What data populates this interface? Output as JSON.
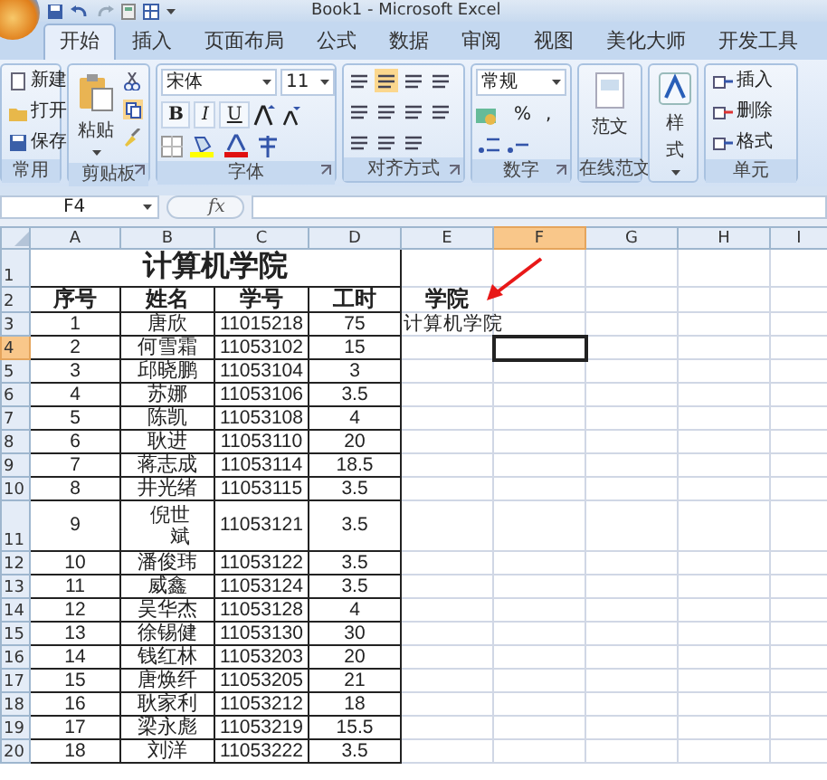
{
  "window": {
    "title": "Book1 - Microsoft Excel"
  },
  "tabs": [
    {
      "label": "开始",
      "selected": true
    },
    {
      "label": "插入",
      "selected": false
    },
    {
      "label": "页面布局",
      "selected": false
    },
    {
      "label": "公式",
      "selected": false
    },
    {
      "label": "数据",
      "selected": false
    },
    {
      "label": "审阅",
      "selected": false
    },
    {
      "label": "视图",
      "selected": false
    },
    {
      "label": "美化大师",
      "selected": false
    },
    {
      "label": "开发工具",
      "selected": false
    }
  ],
  "ribbon": {
    "groups": [
      {
        "kind": "file",
        "label": "常用",
        "items": [
          "新建",
          "打开",
          "保存"
        ]
      },
      {
        "kind": "clipboard",
        "label": "剪贴板",
        "paste": "粘贴"
      },
      {
        "kind": "font",
        "label": "字体",
        "font_name": "宋体",
        "font_size": "11",
        "buttons": [
          "B",
          "I",
          "U"
        ]
      },
      {
        "kind": "align",
        "label": "对齐方式"
      },
      {
        "kind": "number",
        "label": "数字",
        "format": "常规",
        "buttons": [
          "%",
          ","
        ]
      },
      {
        "kind": "big",
        "label": "在线范文",
        "button": "范文"
      },
      {
        "kind": "style",
        "button": "样式"
      },
      {
        "kind": "cells",
        "label": "单元",
        "items": [
          "插入",
          "删除",
          "格式"
        ]
      }
    ]
  },
  "formula_bar": {
    "name_box": "F4",
    "fx": "fx"
  },
  "sheet": {
    "columns": [
      {
        "label": "A",
        "selected": false
      },
      {
        "label": "B",
        "selected": false
      },
      {
        "label": "C",
        "selected": false
      },
      {
        "label": "D",
        "selected": false
      },
      {
        "label": "E",
        "selected": false
      },
      {
        "label": "F",
        "selected": true
      },
      {
        "label": "G",
        "selected": false
      },
      {
        "label": "H",
        "selected": false
      },
      {
        "label": "I",
        "selected": false
      }
    ],
    "rows": [
      {
        "header": "1",
        "selected": false,
        "kind": "title",
        "title": "计算机学院"
      },
      {
        "header": "2",
        "selected": false,
        "kind": "header",
        "cells": [
          "序号",
          "姓名",
          "学号",
          "工时"
        ],
        "column_e": "学院"
      },
      {
        "header": "3",
        "selected": false,
        "kind": "data",
        "cells": [
          "1",
          "唐欣",
          "11015218",
          "75"
        ],
        "column_e": "计算机学院"
      },
      {
        "header": "4",
        "selected": true,
        "kind": "data",
        "cells": [
          "2",
          "何雪霜",
          "11053102",
          "15"
        ]
      },
      {
        "header": "5",
        "selected": false,
        "kind": "data",
        "cells": [
          "3",
          "邱晓鹏",
          "11053104",
          "3"
        ]
      },
      {
        "header": "6",
        "selected": false,
        "kind": "data",
        "cells": [
          "4",
          "苏娜",
          "11053106",
          "3.5"
        ]
      },
      {
        "header": "7",
        "selected": false,
        "kind": "data",
        "cells": [
          "5",
          "陈凯",
          "11053108",
          "4"
        ]
      },
      {
        "header": "8",
        "selected": false,
        "kind": "data",
        "cells": [
          "6",
          "耿进",
          "11053110",
          "20"
        ]
      },
      {
        "header": "9",
        "selected": false,
        "kind": "data",
        "cells": [
          "7",
          "蒋志成",
          "11053114",
          "18.5"
        ]
      },
      {
        "header": "10",
        "selected": false,
        "kind": "data",
        "cells": [
          "8",
          "井光绪",
          "11053115",
          "3.5"
        ]
      },
      {
        "header": "11",
        "selected": false,
        "kind": "tall",
        "cells": [
          "9",
          "倪世斌",
          "11053121",
          "3.5"
        ]
      },
      {
        "header": "12",
        "selected": false,
        "kind": "data",
        "cells": [
          "10",
          "潘俊玮",
          "11053122",
          "3.5"
        ]
      },
      {
        "header": "13",
        "selected": false,
        "kind": "data",
        "cells": [
          "11",
          "威鑫",
          "11053124",
          "3.5"
        ]
      },
      {
        "header": "14",
        "selected": false,
        "kind": "data",
        "cells": [
          "12",
          "吴华杰",
          "11053128",
          "4"
        ]
      },
      {
        "header": "15",
        "selected": false,
        "kind": "data",
        "cells": [
          "13",
          "徐锡健",
          "11053130",
          "30"
        ]
      },
      {
        "header": "16",
        "selected": false,
        "kind": "data",
        "cells": [
          "14",
          "钱红林",
          "11053203",
          "20"
        ]
      },
      {
        "header": "17",
        "selected": false,
        "kind": "data",
        "cells": [
          "15",
          "唐焕纤",
          "11053205",
          "21"
        ]
      },
      {
        "header": "18",
        "selected": false,
        "kind": "data",
        "cells": [
          "16",
          "耿家利",
          "11053212",
          "18"
        ]
      },
      {
        "header": "19",
        "selected": false,
        "kind": "data",
        "cells": [
          "17",
          "梁永彪",
          "11053219",
          "15.5"
        ]
      },
      {
        "header": "20",
        "selected": false,
        "kind": "data",
        "cells": [
          "18",
          "刘洋",
          "11053222",
          "3.5"
        ]
      }
    ]
  }
}
